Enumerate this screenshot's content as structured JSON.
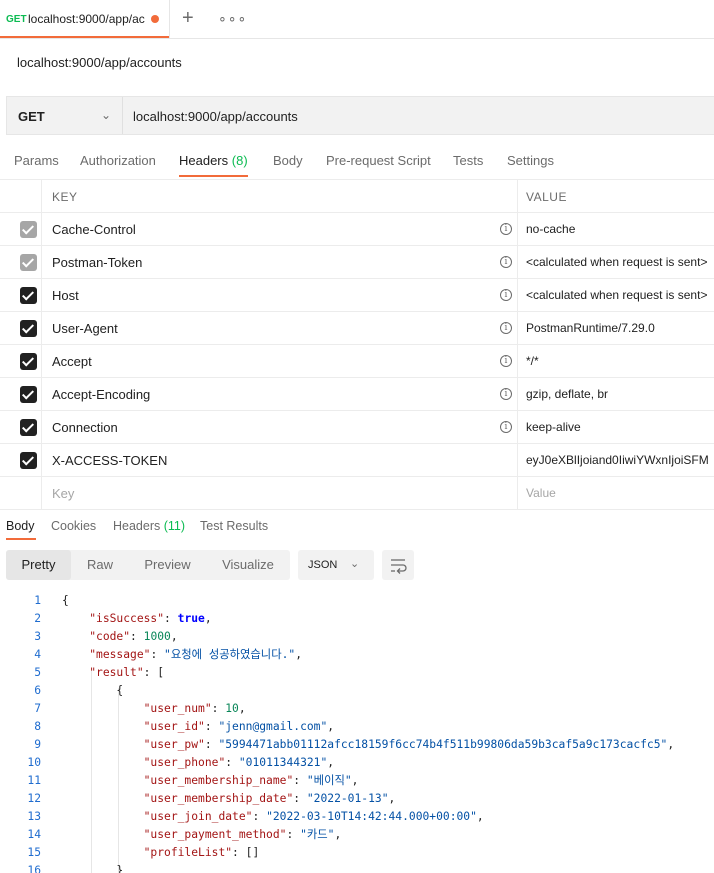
{
  "tab": {
    "method": "GET",
    "url": "localhost:9000/app/ac"
  },
  "tab_actions": {
    "new": "+",
    "more": "∘∘∘"
  },
  "request": {
    "title": "localhost:9000/app/accounts",
    "method": "GET",
    "url": "localhost:9000/app/accounts"
  },
  "request_tabs": [
    {
      "label": "Params"
    },
    {
      "label": "Authorization"
    },
    {
      "label": "Headers",
      "count": "(8)"
    },
    {
      "label": "Body"
    },
    {
      "label": "Pre-request Script"
    },
    {
      "label": "Tests"
    },
    {
      "label": "Settings"
    }
  ],
  "headers_table": {
    "columns": {
      "key": "KEY",
      "value": "VALUE"
    },
    "rows": [
      {
        "key": "Cache-Control",
        "value": "no-cache",
        "checked": true,
        "locked": true
      },
      {
        "key": "Postman-Token",
        "value": "<calculated when request is sent>",
        "checked": true,
        "locked": true
      },
      {
        "key": "Host",
        "value": "<calculated when request is sent>",
        "checked": true,
        "locked": false
      },
      {
        "key": "User-Agent",
        "value": "PostmanRuntime/7.29.0",
        "checked": true,
        "locked": false
      },
      {
        "key": "Accept",
        "value": "*/*",
        "checked": true,
        "locked": false
      },
      {
        "key": "Accept-Encoding",
        "value": "gzip, deflate, br",
        "checked": true,
        "locked": false
      },
      {
        "key": "Connection",
        "value": "keep-alive",
        "checked": true,
        "locked": false
      },
      {
        "key": "X-ACCESS-TOKEN",
        "value": "eyJ0eXBlIjoiand0IiwiYWxnIjoiSFM",
        "checked": true,
        "locked": false
      }
    ],
    "placeholder": {
      "key": "Key",
      "value": "Value"
    }
  },
  "response_tabs": [
    {
      "label": "Body"
    },
    {
      "label": "Cookies"
    },
    {
      "label": "Headers",
      "count": "(11)"
    },
    {
      "label": "Test Results"
    }
  ],
  "view_modes": [
    "Pretty",
    "Raw",
    "Preview",
    "Visualize"
  ],
  "format": "JSON",
  "code_lines": [
    {
      "n": "1",
      "parts": [
        [
          "p",
          "{"
        ]
      ]
    },
    {
      "n": "2",
      "parts": [
        [
          "p",
          "    "
        ],
        [
          "k",
          "\"isSuccess\""
        ],
        [
          "p",
          ": "
        ],
        [
          "b",
          "true"
        ],
        [
          "p",
          ","
        ]
      ]
    },
    {
      "n": "3",
      "parts": [
        [
          "p",
          "    "
        ],
        [
          "k",
          "\"code\""
        ],
        [
          "p",
          ": "
        ],
        [
          "n",
          "1000"
        ],
        [
          "p",
          ","
        ]
      ]
    },
    {
      "n": "4",
      "parts": [
        [
          "p",
          "    "
        ],
        [
          "k",
          "\"message\""
        ],
        [
          "p",
          ": "
        ],
        [
          "s",
          "\"요청에 성공하였습니다.\""
        ],
        [
          "p",
          ","
        ]
      ]
    },
    {
      "n": "5",
      "parts": [
        [
          "p",
          "    "
        ],
        [
          "k",
          "\"result\""
        ],
        [
          "p",
          ": ["
        ]
      ]
    },
    {
      "n": "6",
      "parts": [
        [
          "p",
          "        {"
        ]
      ]
    },
    {
      "n": "7",
      "parts": [
        [
          "p",
          "            "
        ],
        [
          "k",
          "\"user_num\""
        ],
        [
          "p",
          ": "
        ],
        [
          "n",
          "10"
        ],
        [
          "p",
          ","
        ]
      ]
    },
    {
      "n": "8",
      "parts": [
        [
          "p",
          "            "
        ],
        [
          "k",
          "\"user_id\""
        ],
        [
          "p",
          ": "
        ],
        [
          "s",
          "\"jenn@gmail.com\""
        ],
        [
          "p",
          ","
        ]
      ]
    },
    {
      "n": "9",
      "parts": [
        [
          "p",
          "            "
        ],
        [
          "k",
          "\"user_pw\""
        ],
        [
          "p",
          ": "
        ],
        [
          "s",
          "\"5994471abb01112afcc18159f6cc74b4f511b99806da59b3caf5a9c173cacfc5\""
        ],
        [
          "p",
          ","
        ]
      ]
    },
    {
      "n": "10",
      "parts": [
        [
          "p",
          "            "
        ],
        [
          "k",
          "\"user_phone\""
        ],
        [
          "p",
          ": "
        ],
        [
          "s",
          "\"01011344321\""
        ],
        [
          "p",
          ","
        ]
      ]
    },
    {
      "n": "11",
      "parts": [
        [
          "p",
          "            "
        ],
        [
          "k",
          "\"user_membership_name\""
        ],
        [
          "p",
          ": "
        ],
        [
          "s",
          "\"베이직\""
        ],
        [
          "p",
          ","
        ]
      ]
    },
    {
      "n": "12",
      "parts": [
        [
          "p",
          "            "
        ],
        [
          "k",
          "\"user_membership_date\""
        ],
        [
          "p",
          ": "
        ],
        [
          "s",
          "\"2022-01-13\""
        ],
        [
          "p",
          ","
        ]
      ]
    },
    {
      "n": "13",
      "parts": [
        [
          "p",
          "            "
        ],
        [
          "k",
          "\"user_join_date\""
        ],
        [
          "p",
          ": "
        ],
        [
          "s",
          "\"2022-03-10T14:42:44.000+00:00\""
        ],
        [
          "p",
          ","
        ]
      ]
    },
    {
      "n": "14",
      "parts": [
        [
          "p",
          "            "
        ],
        [
          "k",
          "\"user_payment_method\""
        ],
        [
          "p",
          ": "
        ],
        [
          "s",
          "\"카드\""
        ],
        [
          "p",
          ","
        ]
      ]
    },
    {
      "n": "15",
      "parts": [
        [
          "p",
          "            "
        ],
        [
          "k",
          "\"profileList\""
        ],
        [
          "p",
          ": []"
        ]
      ]
    },
    {
      "n": "16",
      "parts": [
        [
          "p",
          "        }"
        ]
      ]
    }
  ],
  "colors": {
    "accent": "#f26b3a",
    "success": "#0cbb52",
    "json_key": "#a31515",
    "json_string": "#0451a5",
    "json_number": "#098658",
    "json_bool": "#0000ff"
  }
}
